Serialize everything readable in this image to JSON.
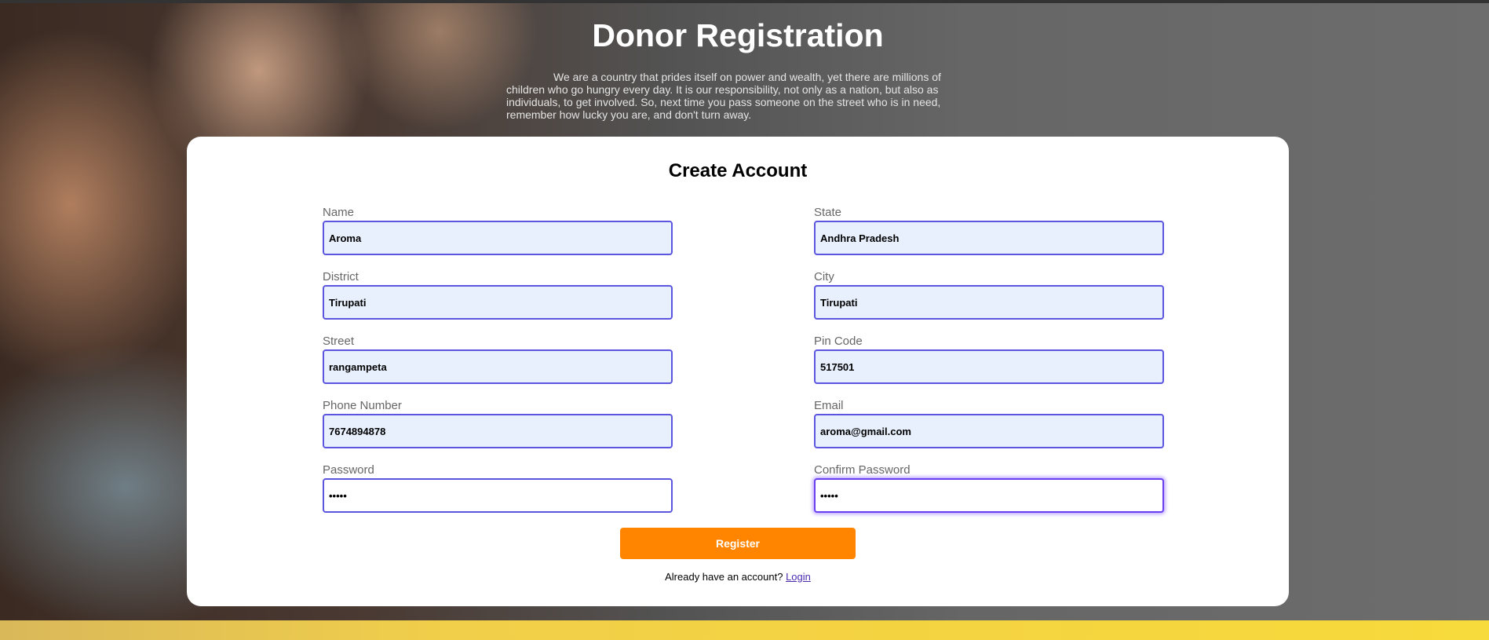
{
  "header": {
    "title": "Donor Registration",
    "intro": "We are a country that prides itself on power and wealth, yet there are millions of children who go hungry every day. It is our responsibility, not only as a nation, but also as individuals, to get involved. So, next time you pass someone on the street who is in need, remember how lucky you are, and don't turn away."
  },
  "form": {
    "title": "Create Account",
    "fields": {
      "name": {
        "label": "Name",
        "value": "Aroma"
      },
      "state": {
        "label": "State",
        "value": "Andhra Pradesh"
      },
      "district": {
        "label": "District",
        "value": "Tirupati"
      },
      "city": {
        "label": "City",
        "value": "Tirupati"
      },
      "street": {
        "label": "Street",
        "value": "rangampeta"
      },
      "pincode": {
        "label": "Pin Code",
        "value": "517501"
      },
      "phone": {
        "label": "Phone Number",
        "value": "7674894878"
      },
      "email": {
        "label": "Email",
        "value": "aroma@gmail.com"
      },
      "password": {
        "label": "Password",
        "value": "•••••"
      },
      "confirm_password": {
        "label": "Confirm Password",
        "value": "•••••"
      }
    },
    "register_label": "Register",
    "login_prompt": "Already have an account?",
    "login_link": "Login"
  },
  "colors": {
    "accent_button": "#ff8500",
    "input_border": "#5b55e0",
    "autofill_bg": "#e8f0fe"
  }
}
